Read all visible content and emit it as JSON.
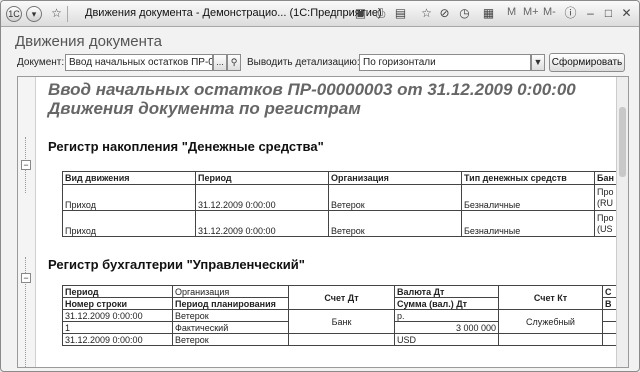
{
  "titlebar": {
    "menu_icon": "1c-logo-icon",
    "title": "Движения документа - Демонстрацио... (1С:Предприятие)",
    "letters": [
      "M",
      "M+",
      "M-"
    ]
  },
  "form": {
    "title": "Движения документа"
  },
  "toolbar": {
    "document_label": "Документ:",
    "document_value": "Ввод начальных остатков ПР-00",
    "document_select": "...",
    "detail_label": "Выводить детализацию:",
    "detail_value": "По горизонтали",
    "generate_button": "Сформировать"
  },
  "report": {
    "heading_line1": "Ввод начальных остатков ПР-00000003 от 31.12.2009 0:00:00",
    "heading_line2": "Движения документа по регистрам",
    "register1": {
      "title": "Регистр накопления \"Денежные средства\"",
      "columns": [
        "Вид движения",
        "Период",
        "Организация",
        "Тип денежных средств",
        "Бан"
      ],
      "rows": [
        [
          "Приход",
          "31.12.2009 0:00:00",
          "Ветерок",
          "Безналичные",
          "Про",
          "(RU"
        ],
        [
          "Приход",
          "31.12.2009 0:00:00",
          "Ветерок",
          "Безналичные",
          "Про",
          "(US"
        ]
      ]
    },
    "register2": {
      "title": "Регистр бухгалтерии \"Управленческий\"",
      "header_top": [
        "Период",
        "Организация",
        "Счет Дт",
        "Валюта Дт",
        "Счет Кт",
        "С"
      ],
      "header_bottom": [
        "Номер строки",
        "Период планирования",
        "Сумма (вал.) Дт",
        "В"
      ],
      "rows": [
        [
          "31.12.2009 0:00:00",
          "Ветерок",
          "Банк",
          "р.",
          "Служебный",
          ""
        ],
        [
          "1",
          "Фактический",
          "",
          "3 000 000",
          "",
          ""
        ],
        [
          "31.12.2009 0:00:00",
          "Ветерок",
          "",
          "USD",
          "",
          ""
        ]
      ]
    }
  }
}
